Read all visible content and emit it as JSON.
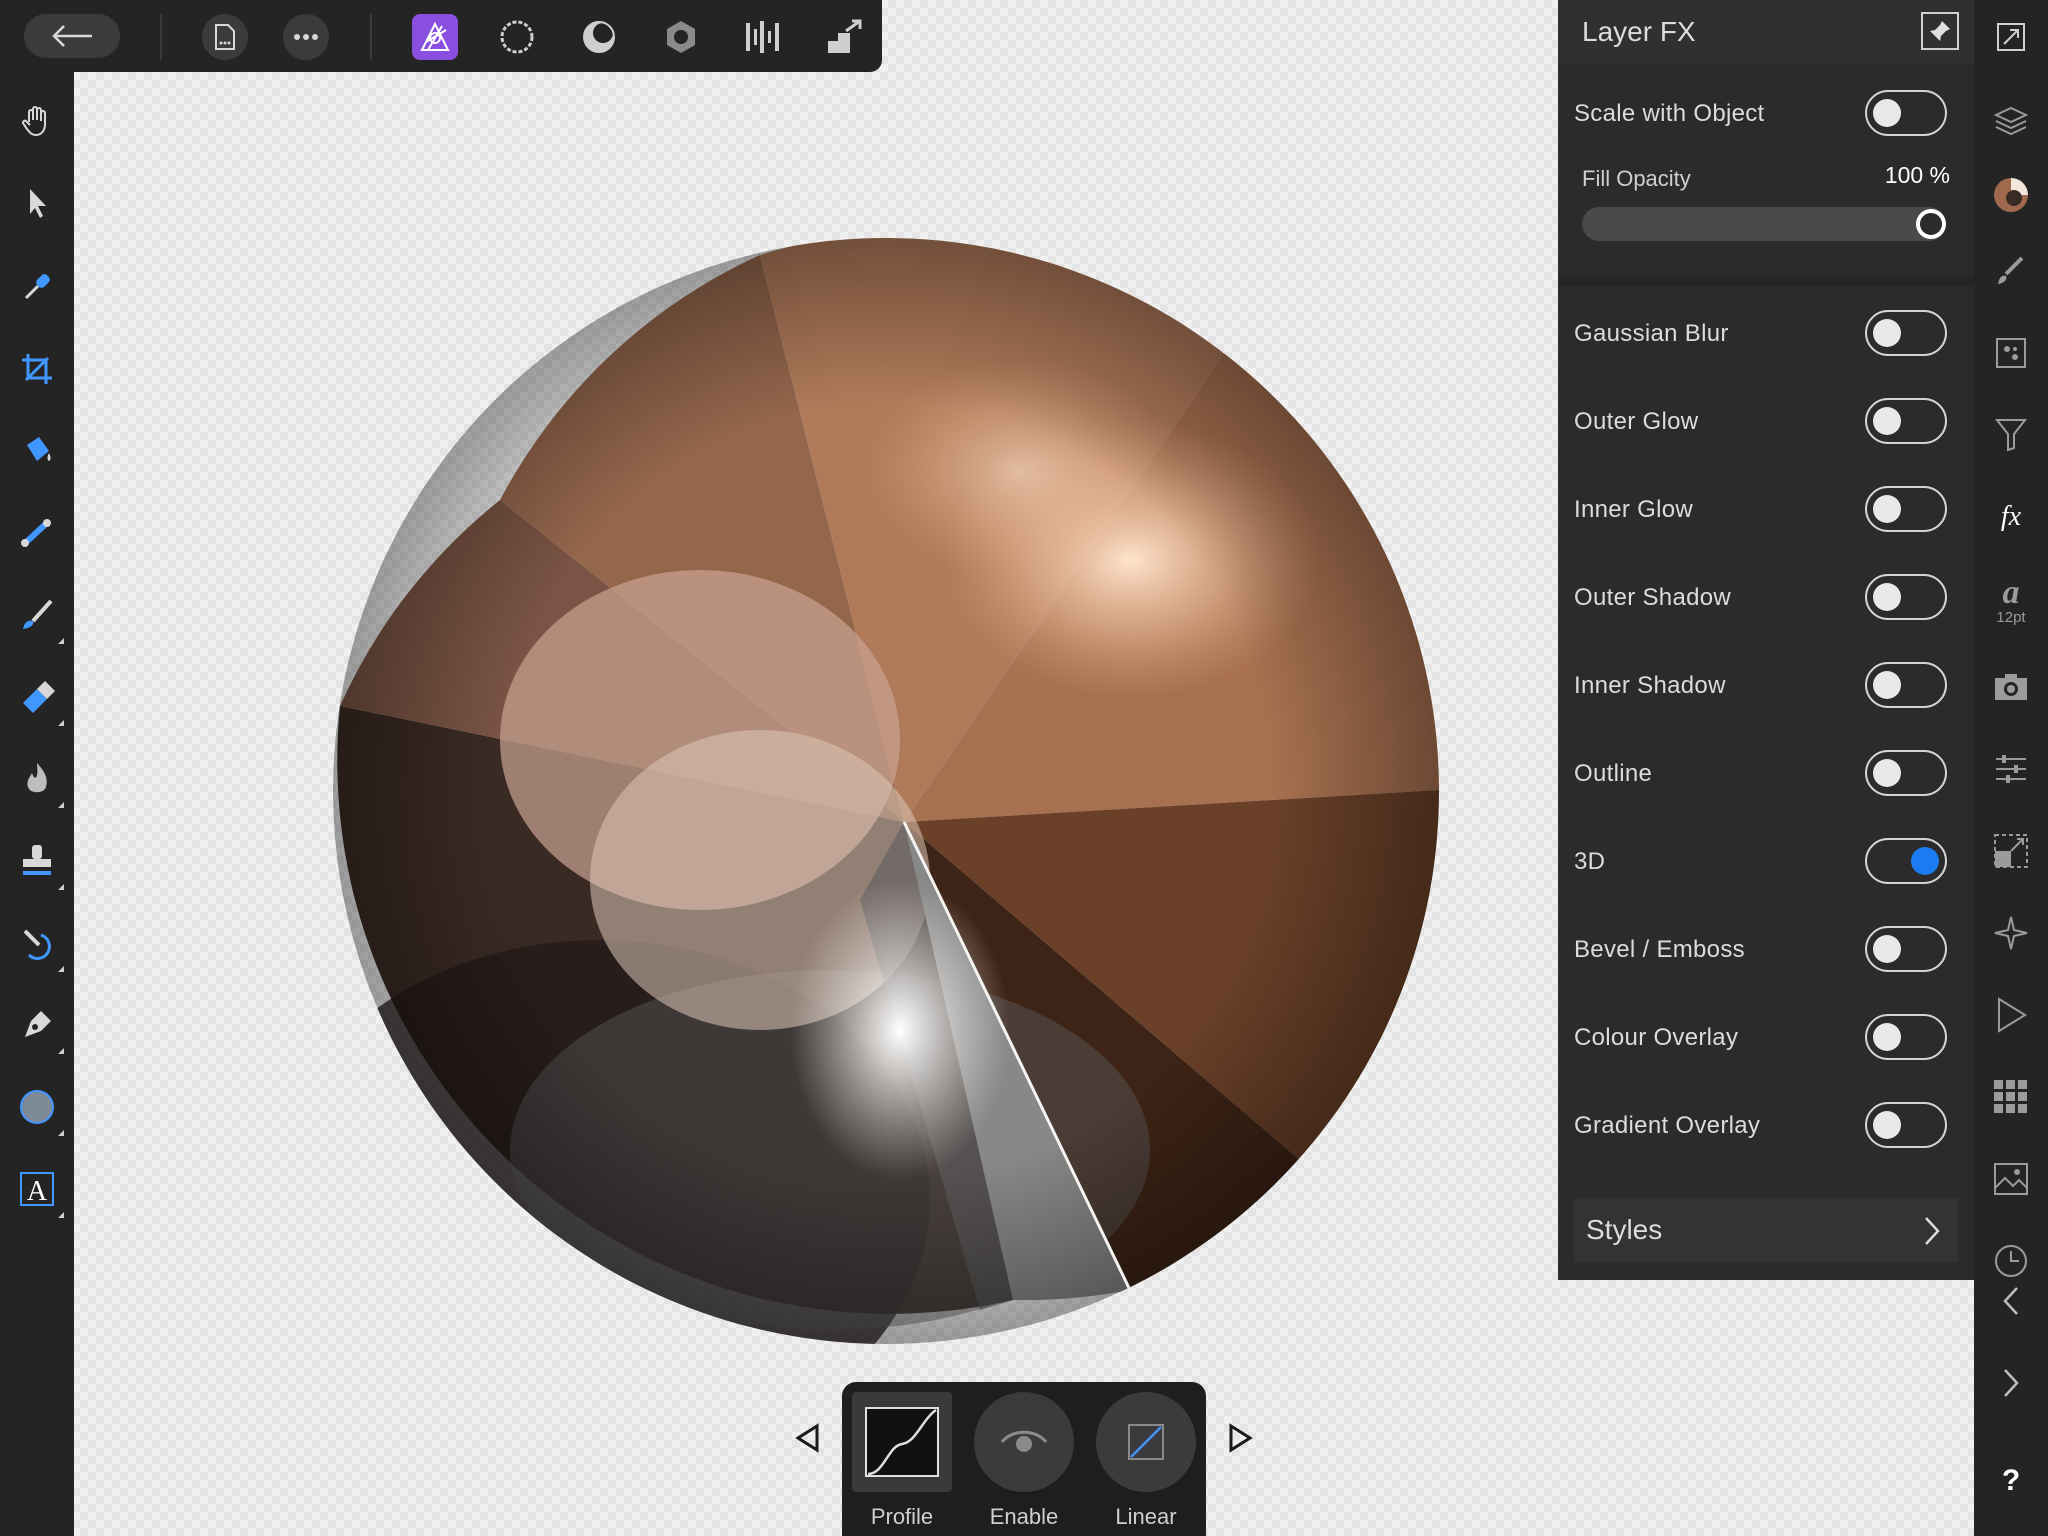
{
  "top_toolbar": {
    "icons": [
      "back-arrow-icon",
      "document-icon",
      "more-icon",
      "photo-persona-icon",
      "liquify-persona-icon",
      "develop-persona-icon",
      "tone-mapping-persona-icon",
      "export-persona-icon",
      "macro-icon"
    ]
  },
  "left_tools": [
    "hand-tool-icon",
    "move-tool-icon",
    "color-picker-icon",
    "crop-tool-icon",
    "flood-fill-icon",
    "gradient-tool-icon",
    "paint-brush-icon",
    "eraser-icon",
    "dodge-burn-icon",
    "clone-stamp-icon",
    "inpainting-icon",
    "pen-tool-icon",
    "ellipse-tool-icon",
    "text-tool-icon"
  ],
  "right_strip": {
    "text_style_size": "12pt",
    "help_label": "?"
  },
  "panel": {
    "title": "Layer FX",
    "scale_with_object": "Scale with Object",
    "fill_opacity_label": "Fill Opacity",
    "fill_opacity_value": "100 %",
    "fill_opacity_fraction": 1.0,
    "effects": [
      {
        "label": "Gaussian Blur",
        "on": false
      },
      {
        "label": "Outer Glow",
        "on": false
      },
      {
        "label": "Inner Glow",
        "on": false
      },
      {
        "label": "Outer Shadow",
        "on": false
      },
      {
        "label": "Inner Shadow",
        "on": false
      },
      {
        "label": "Outline",
        "on": false
      },
      {
        "label": "3D",
        "on": true
      },
      {
        "label": "Bevel / Emboss",
        "on": false
      },
      {
        "label": "Colour Overlay",
        "on": false
      },
      {
        "label": "Gradient Overlay",
        "on": false
      }
    ],
    "styles_label": "Styles"
  },
  "context_bar": {
    "items": [
      {
        "label": "Profile"
      },
      {
        "label": "Enable"
      },
      {
        "label": "Linear"
      }
    ]
  },
  "colors": {
    "accent": "#1a7cf0",
    "persona_active": "#8a4fe0",
    "panel_bg": "#2b2b2b",
    "toolbar_bg": "#242424"
  }
}
